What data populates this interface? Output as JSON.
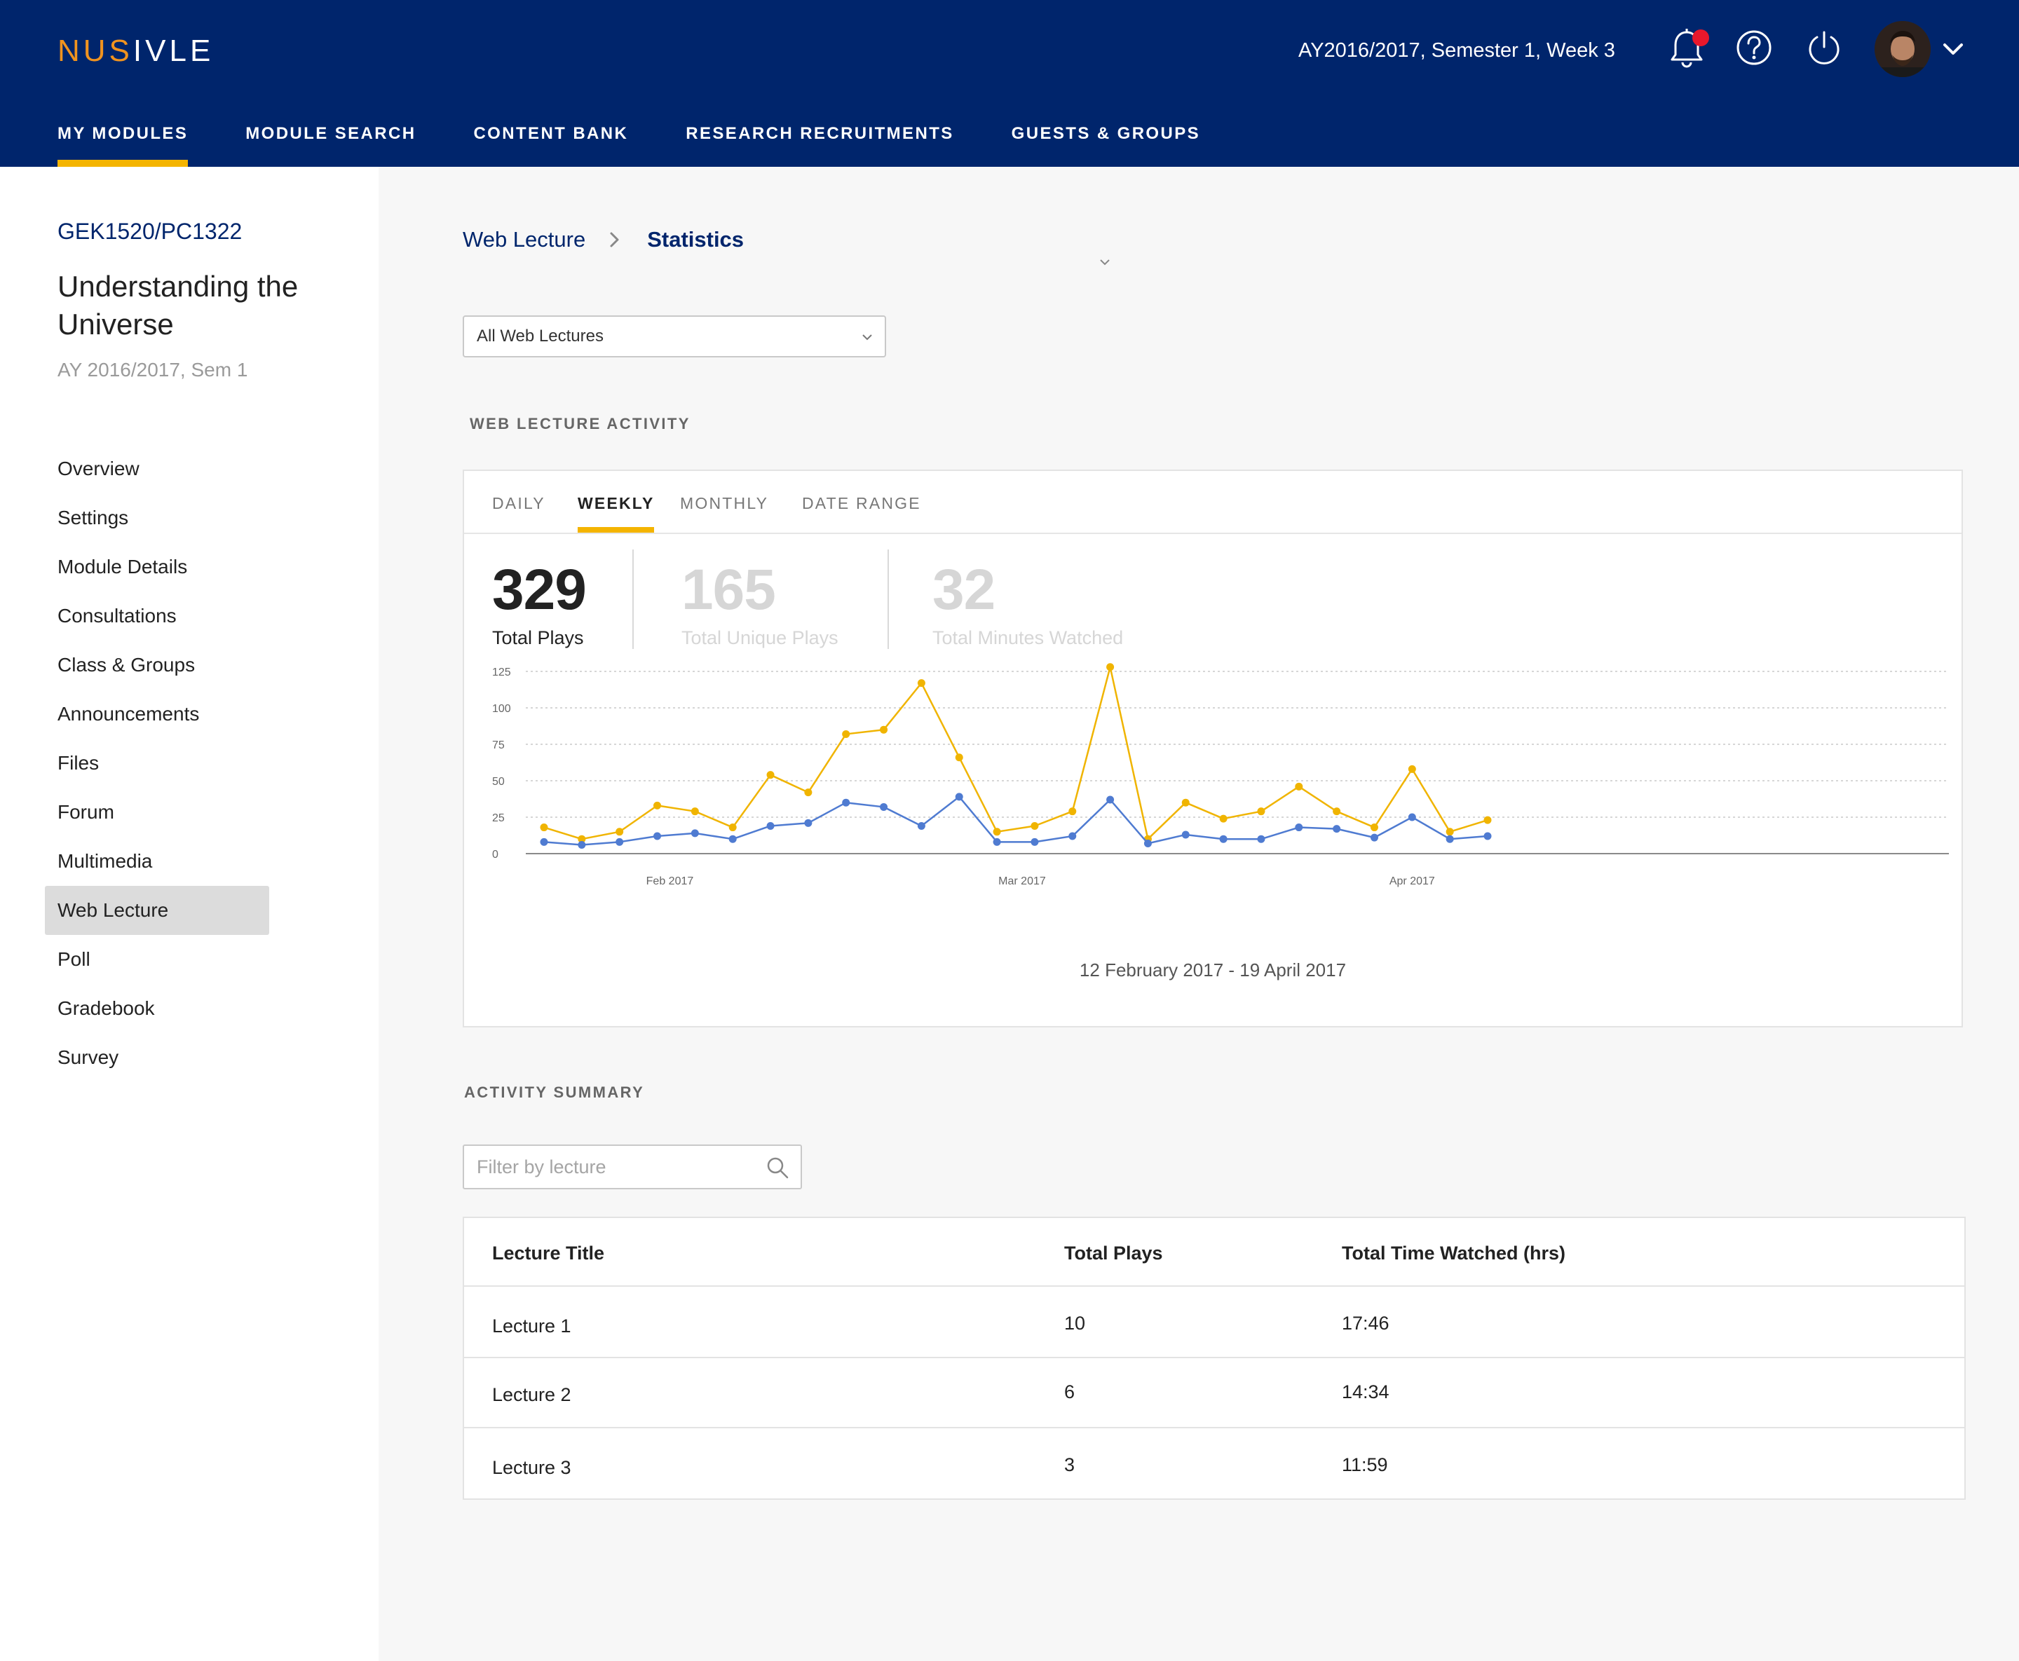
{
  "header": {
    "logo_part1": "NUS",
    "logo_part2": "IVLE",
    "term": "AY2016/2017, Semester 1, Week 3"
  },
  "nav": [
    {
      "label": "MY MODULES",
      "active": true
    },
    {
      "label": "MODULE SEARCH"
    },
    {
      "label": "CONTENT BANK"
    },
    {
      "label": "RESEARCH RECRUITMENTS"
    },
    {
      "label": "GUESTS & GROUPS"
    }
  ],
  "sidebar": {
    "code": "GEK1520/PC1322",
    "name": "Understanding the Universe",
    "semester": "AY 2016/2017, Sem 1",
    "items": [
      {
        "label": "Overview"
      },
      {
        "label": "Settings"
      },
      {
        "label": "Module Details"
      },
      {
        "label": "Consultations"
      },
      {
        "label": "Class & Groups"
      },
      {
        "label": "Announcements"
      },
      {
        "label": "Files"
      },
      {
        "label": "Forum"
      },
      {
        "label": "Multimedia"
      },
      {
        "label": "Web Lecture",
        "active": true
      },
      {
        "label": "Poll"
      },
      {
        "label": "Gradebook"
      },
      {
        "label": "Survey"
      }
    ]
  },
  "breadcrumb": {
    "parent": "Web Lecture",
    "current": "Statistics"
  },
  "lecture_select": {
    "value": "All Web Lectures"
  },
  "activity": {
    "title": "WEB LECTURE ACTIVITY",
    "tabs": [
      {
        "label": "DAILY"
      },
      {
        "label": "WEEKLY",
        "active": true
      },
      {
        "label": "MONTHLY"
      },
      {
        "label": "DATE RANGE"
      }
    ],
    "stats": [
      {
        "value": "329",
        "label": "Total Plays"
      },
      {
        "value": "165",
        "label": "Total Unique Plays"
      },
      {
        "value": "32",
        "label": "Total Minutes Watched"
      }
    ],
    "range": "12 February 2017 - 19 April 2017"
  },
  "chart_data": {
    "type": "line",
    "x": [
      "2017-01-22",
      "2017-01-25",
      "2017-01-28",
      "2017-01-31",
      "2017-02-03",
      "2017-02-06",
      "2017-02-09",
      "2017-02-12",
      "2017-02-15",
      "2017-02-18",
      "2017-02-21",
      "2017-02-24",
      "2017-02-27",
      "2017-03-02",
      "2017-03-05",
      "2017-03-08",
      "2017-03-11",
      "2017-03-14",
      "2017-03-17",
      "2017-03-20",
      "2017-03-23",
      "2017-03-26",
      "2017-03-29",
      "2017-04-01",
      "2017-04-04",
      "2017-04-07"
    ],
    "x_ticks": [
      "Feb 2017",
      "Mar 2017",
      "Apr 2017"
    ],
    "y_ticks": [
      "125",
      "100",
      "75",
      "50",
      "25",
      "0"
    ],
    "ylim": [
      0,
      125
    ],
    "grid": true,
    "series": [
      {
        "color": "#f0b400",
        "values": [
          18,
          10,
          15,
          33,
          29,
          18,
          54,
          42,
          82,
          85,
          117,
          66,
          15,
          19,
          29,
          128,
          10,
          35,
          24,
          29,
          46,
          29,
          18,
          58,
          15,
          23
        ]
      },
      {
        "color": "#4f7bd1",
        "values": [
          8,
          6,
          8,
          12,
          14,
          10,
          19,
          21,
          35,
          32,
          19,
          39,
          8,
          8,
          12,
          37,
          7,
          13,
          10,
          10,
          18,
          17,
          11,
          25,
          10,
          12
        ]
      }
    ]
  },
  "summary": {
    "title": "ACTIVITY SUMMARY",
    "filter_placeholder": "Filter by lecture",
    "columns": [
      "Lecture Title",
      "Total Plays",
      "Total Time Watched (hrs)"
    ],
    "rows": [
      [
        "Lecture 1",
        "10",
        "17:46"
      ],
      [
        "Lecture 2",
        "6",
        "14:34"
      ],
      [
        "Lecture 3",
        "3",
        "11:59"
      ]
    ]
  }
}
